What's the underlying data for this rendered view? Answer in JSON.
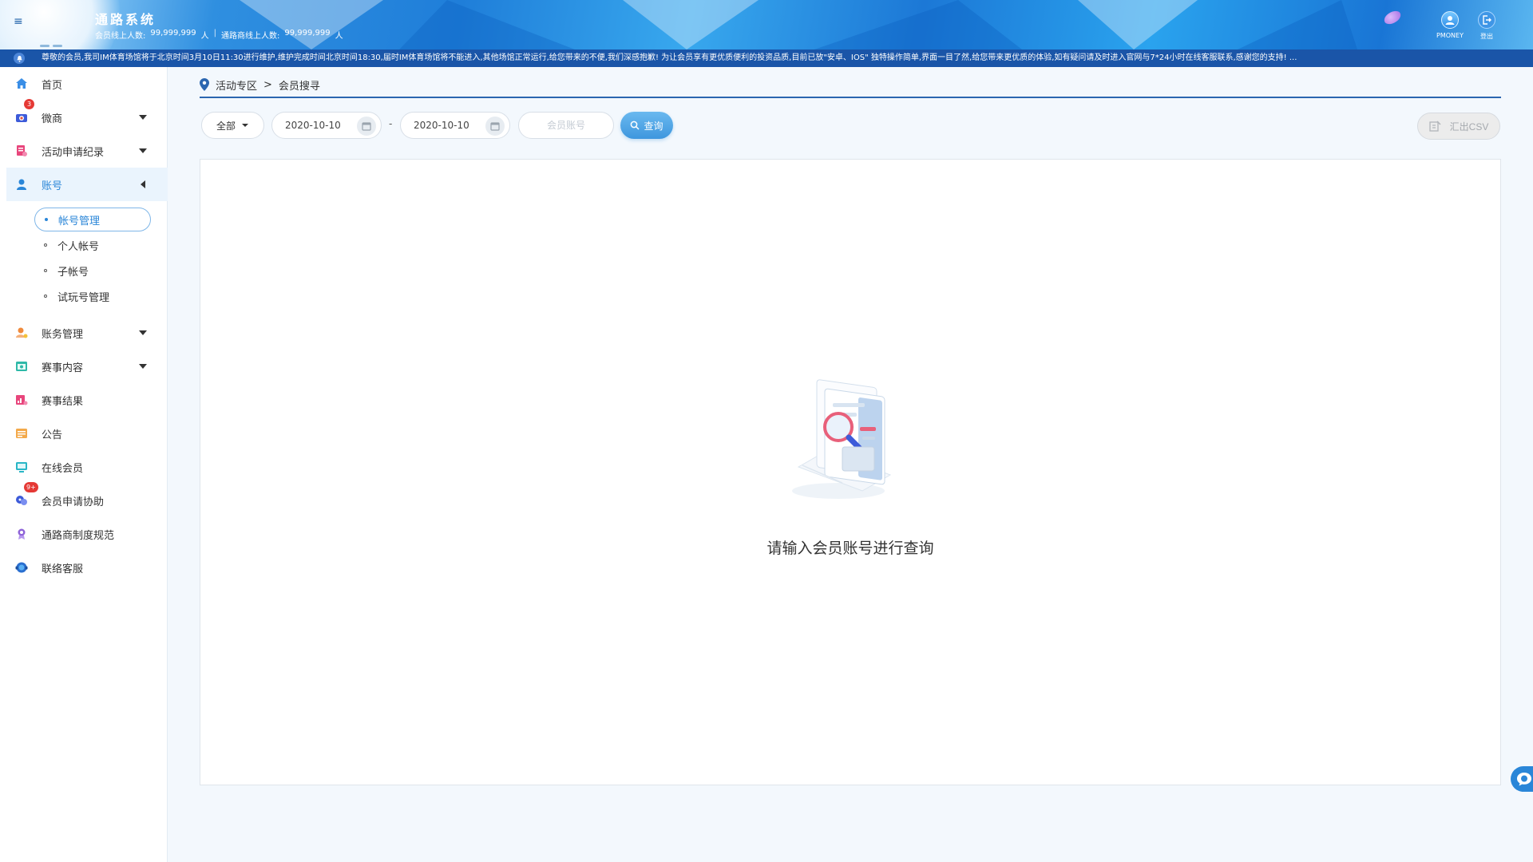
{
  "header": {
    "title": "通路系统",
    "stats": {
      "member_online_label": "会员线上人数:",
      "member_online_value": "99,999,999",
      "member_online_unit": "人",
      "separator": "|",
      "agent_online_label": "通路商线上人数:",
      "agent_online_value": "99,999,999",
      "agent_online_unit": "人"
    },
    "user_label": "PMONEY",
    "logout_label": "登出"
  },
  "marquee": {
    "text": "尊敬的会员,我司IM体育场馆将于北京时间3月10日11:30进行维护,维护完成时间北京时间18:30,届时IM体育场馆将不能进入,其他场馆正常运行,给您带来的不便,我们深感抱歉! 为让会员享有更优质便利的投资品质,目前已放\"安卓、IOS\" 独特操作简单,界面一目了然,给您带来更优质的体验,如有疑问请及时进入官网与7*24小时在线客服联系,感谢您的支持! ..."
  },
  "sidebar": {
    "items": [
      {
        "label": "首页",
        "icon": "home-icon"
      },
      {
        "label": "微商",
        "icon": "wechat-shop-icon",
        "badge": "3"
      },
      {
        "label": "活动申请纪录",
        "icon": "activity-record-icon"
      },
      {
        "label": "账号",
        "icon": "account-icon"
      },
      {
        "label": "账务管理",
        "icon": "finance-icon"
      },
      {
        "label": "赛事内容",
        "icon": "event-content-icon"
      },
      {
        "label": "赛事结果",
        "icon": "event-result-icon"
      },
      {
        "label": "公告",
        "icon": "announcement-icon"
      },
      {
        "label": "在线会员",
        "icon": "online-member-icon"
      },
      {
        "label": "会员申请协助",
        "icon": "member-assist-icon",
        "badge": "9+"
      },
      {
        "label": "通路商制度规范",
        "icon": "agent-rules-icon"
      },
      {
        "label": "联络客服",
        "icon": "customer-service-icon"
      }
    ],
    "account_sub": [
      {
        "label": "帐号管理"
      },
      {
        "label": "个人帐号"
      },
      {
        "label": "子帐号"
      },
      {
        "label": "试玩号管理"
      }
    ]
  },
  "breadcrumb": {
    "parent": "活动专区",
    "separator": ">",
    "current": "会员搜寻"
  },
  "filters": {
    "type_value": "全部",
    "date_start": "2020-10-10",
    "date_separator": "-",
    "date_end": "2020-10-10",
    "member_placeholder": "会员账号",
    "search_label": "查询",
    "export_label": "汇出CSV"
  },
  "empty_state": {
    "message": "请输入会员账号进行查询"
  },
  "colors": {
    "primary": "#2a86d8",
    "marquee_bg": "#1a55a8",
    "breadcrumb_line": "#2b66b0",
    "badge": "#e53935"
  }
}
